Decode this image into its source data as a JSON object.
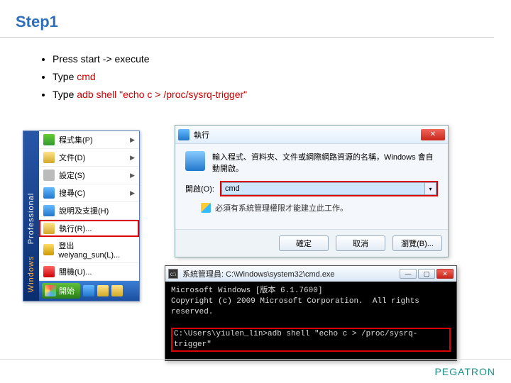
{
  "title": "Step1",
  "instructions": {
    "item1_a": "Press start -> execute",
    "item2_a": "Type ",
    "item2_b": "cmd",
    "item3_a": "Type ",
    "item3_b": "adb shell \"echo c > /proc/sysrq-trigger\""
  },
  "startmenu": {
    "side_a": "Windows",
    "side_b": "Professional",
    "items": {
      "programs": "程式集(P)",
      "documents": "文件(D)",
      "settings": "設定(S)",
      "search": "搜尋(C)",
      "help": "說明及支援(H)",
      "run": "執行(R)...",
      "logoff": "登出 weiyang_sun(L)...",
      "shutdown": "關機(U)..."
    },
    "startbtn": "開始"
  },
  "run": {
    "title": "執行",
    "desc": "輸入程式、資料夾、文件或網際網路資源的名稱，Windows 會自動開啟。",
    "open_label": "開啟(O):",
    "value": "cmd",
    "warn": "必須有系統管理權限才能建立此工作。",
    "ok": "確定",
    "cancel": "取消",
    "browse": "瀏覽(B)..."
  },
  "cmd": {
    "title": "系統管理員: C:\\Windows\\system32\\cmd.exe",
    "line1": "Microsoft Windows [版本 6.1.7600]",
    "line2": "Copyright (c) 2009 Microsoft Corporation.  All rights reserved.",
    "prompt": "C:\\Users\\yiulen_lin>",
    "input": "adb shell \"echo c > /proc/sysrq-trigger\""
  },
  "brand": "PEGATRON"
}
